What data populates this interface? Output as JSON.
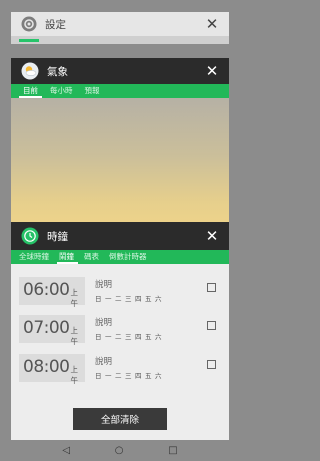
{
  "recents": {
    "settings": {
      "title": "設定",
      "close": "✕"
    },
    "weather": {
      "title": "氣象",
      "close": "✕",
      "tabs": [
        {
          "label": "目前"
        },
        {
          "label": "每小時"
        },
        {
          "label": "預報"
        }
      ]
    },
    "clock": {
      "title": "時鐘",
      "close": "✕",
      "tabs": [
        {
          "label": "全球時鐘"
        },
        {
          "label": "鬧鐘"
        },
        {
          "label": "碼表"
        },
        {
          "label": "倒數計時器"
        }
      ],
      "alarms": [
        {
          "time": "06:00",
          "ampm": "上午",
          "desc": "說明"
        },
        {
          "time": "07:00",
          "ampm": "上午",
          "desc": "說明"
        },
        {
          "time": "08:00",
          "ampm": "上午",
          "desc": "說明"
        }
      ],
      "days": [
        "日",
        "一",
        "二",
        "三",
        "四",
        "五",
        "六"
      ]
    },
    "clear_all": "全部清除"
  },
  "nav": {
    "back": "◁",
    "home": "○",
    "recents": "□"
  },
  "colors": {
    "accent": "#22b859",
    "titlebar": "#2b2b2b"
  }
}
